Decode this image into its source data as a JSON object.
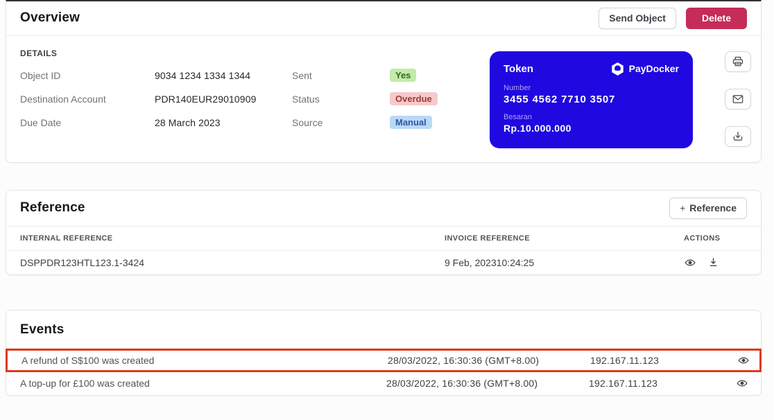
{
  "overview": {
    "title": "Overview",
    "send_button_label": "Send Object",
    "delete_button_label": "Delete",
    "details_heading": "DETAILS",
    "fields": [
      {
        "label": "Object ID",
        "value": "9034 1234 1334 1344"
      },
      {
        "label": "Destination Account",
        "value": "PDR140EUR29010909"
      },
      {
        "label": "Due Date",
        "value": "28 March 2023"
      }
    ],
    "statuses": [
      {
        "label": "Sent",
        "badge": "Yes",
        "color": "#c3eba9"
      },
      {
        "label": "Status",
        "badge": "Overdue",
        "color": "#f6caca"
      },
      {
        "label": "Source",
        "badge": "Manual",
        "color": "#b9d9f6"
      }
    ],
    "token_card": {
      "title": "Token",
      "brand": "PayDocker",
      "number_label": "Number",
      "number": "3455 4562 7710 3507",
      "amount_label": "Besaran",
      "amount": "Rp.10.000.000",
      "bg_color": "#2008e0"
    },
    "side_icons": [
      "printer-icon",
      "mail-icon",
      "download-icon"
    ]
  },
  "reference": {
    "title": "Reference",
    "add_button_plus": "+",
    "add_button_label": "Reference",
    "columns": [
      "INTERNAL REFERENCE",
      "INVOICE REFERENCE",
      "ACTIONS"
    ],
    "rows": [
      {
        "internal": "DSPPDR123HTL123.1-3424",
        "invoice": "9 Feb, 202310:24:25"
      }
    ]
  },
  "events": {
    "title": "Events",
    "rows": [
      {
        "message": "A refund of S$100 was created",
        "timestamp": "28/03/2022, 16:30:36 (GMT+8.00)",
        "ip": "192.167.11.123",
        "highlighted": true
      },
      {
        "message": "A top-up for £100 was created",
        "timestamp": "28/03/2022, 16:30:36 (GMT+8.00)",
        "ip": "192.167.11.123",
        "highlighted": false
      }
    ],
    "highlight_color": "#e2391c"
  },
  "colors": {
    "danger_button": "#c52c58",
    "token_card_bg": "#2008e0",
    "badge_green_bg": "#c3eba9",
    "badge_red_bg": "#f6caca",
    "badge_blue_bg": "#b9d9f6"
  }
}
